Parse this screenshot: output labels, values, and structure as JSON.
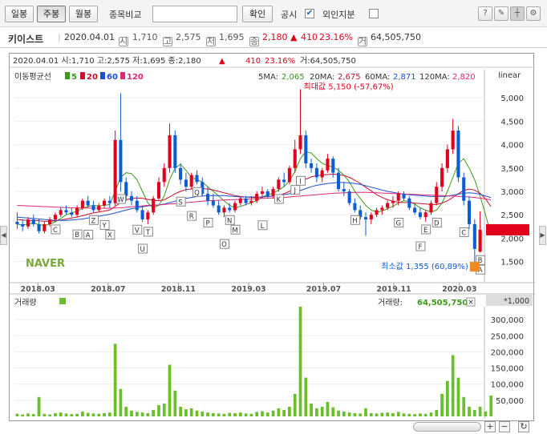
{
  "toolbar": {
    "day_label": "일봉",
    "week_label": "주봉",
    "month_label": "월봉",
    "compare_label": "종목비교",
    "compare_placeholder": "",
    "confirm_label": "확인",
    "disclosure_label": "공시",
    "foreign_label": "외인지분"
  },
  "info": {
    "name": "키이스트",
    "date": "2020.04.01",
    "open_badge": "시",
    "open": "1,710",
    "high_badge": "고",
    "high": "2,575",
    "low_badge": "저",
    "low": "1,695",
    "close_badge": "종",
    "close": "2,180",
    "change_arrow": "▲",
    "change": "410",
    "change_pct": "23.16%",
    "volume_badge": "거",
    "volume": "64,505,750"
  },
  "chart_header": {
    "text_prefix": "2020.04.01 시:1,710 고:2,575 저:1,695 종:2,180",
    "arrow": "▲",
    "change": "410",
    "change_pct": "23.16%",
    "text_suffix": "거:64,505,750"
  },
  "ma_legend": {
    "title": "이동평균선",
    "ma5": "5",
    "ma20": "20",
    "ma60": "60",
    "ma120": "120",
    "ma5_label": "5MA:",
    "ma5_value": "2,065",
    "ma20_label": "20MA:",
    "ma20_value": "2,675",
    "ma60_label": "60MA:",
    "ma60_value": "2,871",
    "ma120_label": "120MA:",
    "ma120_value": "2,820",
    "scale": "linear"
  },
  "annotations": {
    "max_label": "최대값 5,150 (-57,67%)",
    "min_label": "최소값 1,355 (60,89%)",
    "watermark": "NAVER"
  },
  "volume_panel": {
    "title": "거래량",
    "value_label": "거래량:",
    "value": "64,505,750",
    "unit": "*1,000"
  },
  "colors": {
    "up": "#e0001b",
    "down": "#0b5cd5",
    "ma5": "#3a9a1a",
    "ma20": "#c8102e",
    "ma60": "#1f4fd0",
    "ma120": "#e0287a",
    "volume": "#6abf2a"
  },
  "chart_data": [
    {
      "type": "candlestick",
      "title": "",
      "y_ticks": [
        "5,000",
        "4,500",
        "4,000",
        "3,500",
        "3,000",
        "2,500",
        "2,000",
        "1,500"
      ],
      "y_range": [
        1100,
        5500
      ],
      "x_ticks": [
        "2018.03",
        "2018.07",
        "2018.11",
        "2019.03",
        "2019.07",
        "2019.11",
        "2020.03"
      ],
      "markers": [
        "C",
        "B",
        "A",
        "Z",
        "Y",
        "X",
        "W",
        "V",
        "U",
        "T",
        "S",
        "R",
        "Q",
        "P",
        "O",
        "N",
        "M",
        "L",
        "K",
        "J",
        "I",
        "H",
        "G",
        "F",
        "E",
        "D",
        "C",
        "B",
        "A"
      ],
      "ohlc": [
        [
          2350,
          2550,
          2200,
          2300
        ],
        [
          2300,
          2400,
          2150,
          2250
        ],
        [
          2250,
          2450,
          2200,
          2400
        ],
        [
          2400,
          2500,
          2250,
          2300
        ],
        [
          2300,
          2400,
          2100,
          2150
        ],
        [
          2150,
          2350,
          2100,
          2300
        ],
        [
          2300,
          2450,
          2250,
          2400
        ],
        [
          2400,
          2550,
          2350,
          2500
        ],
        [
          2500,
          2650,
          2450,
          2600
        ],
        [
          2600,
          2700,
          2500,
          2550
        ],
        [
          2550,
          2650,
          2450,
          2500
        ],
        [
          2500,
          2700,
          2450,
          2650
        ],
        [
          2650,
          2850,
          2600,
          2800
        ],
        [
          2800,
          2900,
          2650,
          2700
        ],
        [
          2700,
          2800,
          2550,
          2600
        ],
        [
          2600,
          2750,
          2550,
          2700
        ],
        [
          2700,
          2850,
          2650,
          2800
        ],
        [
          2800,
          2900,
          2650,
          2750
        ],
        [
          2750,
          4300,
          2700,
          4100
        ],
        [
          4100,
          5100,
          3000,
          3200
        ],
        [
          3200,
          3300,
          2800,
          2900
        ],
        [
          2900,
          3000,
          2700,
          2800
        ],
        [
          2800,
          2900,
          2550,
          2600
        ],
        [
          2600,
          2700,
          2350,
          2400
        ],
        [
          2400,
          2600,
          2300,
          2550
        ],
        [
          2550,
          2900,
          2500,
          2850
        ],
        [
          2850,
          3300,
          2800,
          3200
        ],
        [
          3200,
          3600,
          3100,
          3500
        ],
        [
          3500,
          4450,
          3400,
          4200
        ],
        [
          4200,
          4300,
          3400,
          3500
        ],
        [
          3500,
          3600,
          3150,
          3250
        ],
        [
          3250,
          3400,
          3000,
          3100
        ],
        [
          3100,
          3400,
          3050,
          3350
        ],
        [
          3350,
          3450,
          3150,
          3200
        ],
        [
          3200,
          3300,
          2900,
          2950
        ],
        [
          2950,
          3100,
          2700,
          2800
        ],
        [
          2800,
          2950,
          2650,
          2700
        ],
        [
          2700,
          2800,
          2500,
          2550
        ],
        [
          2550,
          2700,
          2450,
          2650
        ],
        [
          2650,
          2750,
          2550,
          2600
        ],
        [
          2600,
          2800,
          2550,
          2750
        ],
        [
          2750,
          2900,
          2700,
          2850
        ],
        [
          2850,
          2900,
          2700,
          2750
        ],
        [
          2750,
          2900,
          2700,
          2800
        ],
        [
          2800,
          3000,
          2750,
          2950
        ],
        [
          2950,
          3100,
          2850,
          3000
        ],
        [
          3000,
          3050,
          2850,
          2900
        ],
        [
          2900,
          3100,
          2850,
          3050
        ],
        [
          3050,
          3300,
          3000,
          3250
        ],
        [
          3250,
          3400,
          3100,
          3200
        ],
        [
          3200,
          3550,
          3150,
          3500
        ],
        [
          3500,
          4100,
          3400,
          3900
        ],
        [
          3900,
          5150,
          3800,
          4200
        ],
        [
          4200,
          4300,
          3500,
          3600
        ],
        [
          3600,
          3700,
          3400,
          3500
        ],
        [
          3500,
          3600,
          3200,
          3300
        ],
        [
          3300,
          3500,
          3200,
          3450
        ],
        [
          3450,
          3800,
          3400,
          3700
        ],
        [
          3700,
          3750,
          3300,
          3400
        ],
        [
          3400,
          3500,
          3000,
          3050
        ],
        [
          3050,
          3200,
          2900,
          3000
        ],
        [
          3000,
          3050,
          2700,
          2750
        ],
        [
          2750,
          2850,
          2550,
          2600
        ],
        [
          2600,
          2700,
          2400,
          2450
        ],
        [
          2450,
          2550,
          2050,
          2400
        ],
        [
          2400,
          2550,
          2300,
          2500
        ],
        [
          2500,
          2650,
          2450,
          2600
        ],
        [
          2600,
          2700,
          2500,
          2650
        ],
        [
          2650,
          2800,
          2600,
          2750
        ],
        [
          2750,
          2900,
          2650,
          2800
        ],
        [
          2800,
          3000,
          2700,
          2950
        ],
        [
          2950,
          3000,
          2800,
          2850
        ],
        [
          2850,
          2900,
          2600,
          2650
        ],
        [
          2650,
          2750,
          2500,
          2550
        ],
        [
          2550,
          2650,
          2400,
          2450
        ],
        [
          2450,
          2600,
          2350,
          2550
        ],
        [
          2550,
          2800,
          2500,
          2750
        ],
        [
          2750,
          3200,
          2700,
          3100
        ],
        [
          3100,
          3600,
          3000,
          3500
        ],
        [
          3500,
          4000,
          3400,
          3900
        ],
        [
          3900,
          4550,
          3800,
          4300
        ],
        [
          4300,
          4400,
          3200,
          3300
        ],
        [
          3300,
          3400,
          2700,
          2800
        ],
        [
          2800,
          2900,
          2200,
          2300
        ],
        [
          2300,
          2400,
          1355,
          1770
        ],
        [
          1710,
          2575,
          1695,
          2180
        ]
      ],
      "ma_series": [
        {
          "name": "5",
          "values": [
            2300,
            2280,
            2300,
            2320,
            2290,
            2270,
            2300,
            2350,
            2420,
            2500,
            2540,
            2580,
            2640,
            2680,
            2700,
            2690,
            2700,
            2720,
            3000,
            3300,
            3400,
            3380,
            3250,
            3000,
            2750,
            2650,
            2700,
            2900,
            3250,
            3500,
            3580,
            3450,
            3300,
            3250,
            3200,
            3100,
            3000,
            2900,
            2800,
            2700,
            2650,
            2680,
            2720,
            2760,
            2800,
            2880,
            2930,
            2960,
            3030,
            3100,
            3230,
            3420,
            3700,
            3850,
            3820,
            3700,
            3600,
            3550,
            3520,
            3450,
            3350,
            3200,
            3000,
            2850,
            2700,
            2600,
            2560,
            2580,
            2630,
            2680,
            2750,
            2800,
            2790,
            2730,
            2650,
            2600,
            2560,
            2600,
            2750,
            3000,
            3300,
            3600,
            3700,
            3500,
            3250,
            2900,
            2500,
            2065
          ]
        },
        {
          "name": "20",
          "values": [
            2400,
            2390,
            2380,
            2380,
            2370,
            2360,
            2360,
            2370,
            2390,
            2410,
            2430,
            2450,
            2480,
            2510,
            2540,
            2560,
            2580,
            2600,
            2680,
            2760,
            2820,
            2850,
            2860,
            2850,
            2830,
            2810,
            2800,
            2820,
            2880,
            2950,
            3000,
            3040,
            3050,
            3060,
            3060,
            3050,
            3030,
            3000,
            2970,
            2940,
            2910,
            2890,
            2880,
            2870,
            2870,
            2880,
            2890,
            2900,
            2920,
            2950,
            3000,
            3080,
            3180,
            3260,
            3310,
            3340,
            3350,
            3360,
            3370,
            3360,
            3340,
            3300,
            3240,
            3170,
            3090,
            3010,
            2930,
            2870,
            2820,
            2790,
            2770,
            2760,
            2760,
            2750,
            2740,
            2730,
            2720,
            2720,
            2750,
            2800,
            2870,
            2950,
            3020,
            3050,
            3030,
            2960,
            2840,
            2675
          ]
        },
        {
          "name": "60",
          "values": [
            2450,
            2440,
            2430,
            2420,
            2410,
            2400,
            2390,
            2380,
            2380,
            2380,
            2390,
            2400,
            2410,
            2430,
            2450,
            2470,
            2490,
            2510,
            2540,
            2570,
            2600,
            2630,
            2650,
            2670,
            2690,
            2700,
            2710,
            2730,
            2760,
            2790,
            2820,
            2850,
            2870,
            2890,
            2900,
            2910,
            2910,
            2910,
            2910,
            2900,
            2890,
            2880,
            2880,
            2880,
            2880,
            2880,
            2890,
            2900,
            2910,
            2930,
            2950,
            2980,
            3020,
            3060,
            3100,
            3130,
            3150,
            3170,
            3180,
            3190,
            3190,
            3180,
            3170,
            3150,
            3120,
            3090,
            3060,
            3030,
            3000,
            2980,
            2960,
            2940,
            2930,
            2920,
            2910,
            2900,
            2890,
            2890,
            2890,
            2900,
            2920,
            2940,
            2960,
            2970,
            2960,
            2940,
            2900,
            2871
          ]
        },
        {
          "name": "120",
          "values": [
            2700,
            2695,
            2690,
            2685,
            2680,
            2675,
            2670,
            2665,
            2660,
            2655,
            2650,
            2648,
            2646,
            2644,
            2642,
            2640,
            2640,
            2640,
            2645,
            2650,
            2660,
            2670,
            2680,
            2690,
            2700,
            2705,
            2710,
            2720,
            2730,
            2740,
            2750,
            2760,
            2770,
            2780,
            2790,
            2800,
            2805,
            2810,
            2815,
            2820,
            2825,
            2830,
            2835,
            2840,
            2845,
            2850,
            2855,
            2860,
            2865,
            2870,
            2880,
            2890,
            2900,
            2910,
            2920,
            2930,
            2940,
            2950,
            2960,
            2965,
            2970,
            2975,
            2980,
            2980,
            2978,
            2975,
            2970,
            2965,
            2960,
            2955,
            2950,
            2945,
            2940,
            2935,
            2930,
            2925,
            2920,
            2915,
            2910,
            2905,
            2900,
            2895,
            2890,
            2880,
            2870,
            2855,
            2840,
            2820
          ]
        }
      ],
      "max_value": 5150,
      "min_value": 1355,
      "last_close": 2180
    },
    {
      "type": "bar",
      "title": "거래량",
      "unit": "*1,000",
      "y_ticks": [
        "300,000",
        "250,000",
        "200,000",
        "150,000",
        "100,000",
        "50,000"
      ],
      "y_range": [
        0,
        340000
      ],
      "volumes": [
        8000,
        6000,
        9000,
        7000,
        60000,
        8000,
        6000,
        10000,
        12000,
        9000,
        7000,
        8000,
        15000,
        11000,
        9000,
        8000,
        10000,
        12000,
        225000,
        85000,
        30000,
        18000,
        14000,
        12000,
        10000,
        20000,
        35000,
        40000,
        160000,
        80000,
        30000,
        22000,
        25000,
        18000,
        15000,
        12000,
        10000,
        9000,
        8000,
        11000,
        10000,
        12000,
        9000,
        8000,
        14000,
        16000,
        12000,
        18000,
        25000,
        20000,
        30000,
        70000,
        340000,
        120000,
        40000,
        25000,
        30000,
        45000,
        28000,
        18000,
        15000,
        12000,
        10000,
        9000,
        25000,
        10000,
        9000,
        11000,
        12000,
        10000,
        14000,
        9000,
        8000,
        7000,
        9000,
        8000,
        12000,
        20000,
        70000,
        110000,
        190000,
        120000,
        60000,
        30000,
        20000,
        30000,
        15000,
        64505
      ]
    }
  ]
}
